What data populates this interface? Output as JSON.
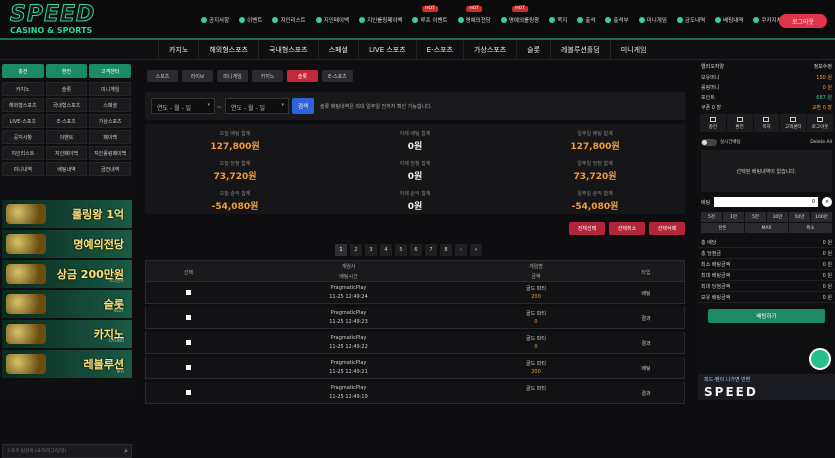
{
  "brand": {
    "name": "SPEED",
    "sub": "CASINO & SPORTS"
  },
  "topnav": [
    {
      "label": "공지사항",
      "hot": ""
    },
    {
      "label": "이벤트",
      "hot": ""
    },
    {
      "label": "지인리스트",
      "hot": ""
    },
    {
      "label": "지인페이백",
      "hot": ""
    },
    {
      "label": "지인롤링페이백",
      "hot": ""
    },
    {
      "label": "루프 이벤트",
      "hot": "HOT"
    },
    {
      "label": "명예의전당",
      "hot": "HOT"
    },
    {
      "label": "명예의롤링왕",
      "hot": "HOT"
    },
    {
      "label": "쪽지",
      "hot": ""
    },
    {
      "label": "출석",
      "hot": ""
    },
    {
      "label": "출석부",
      "hot": ""
    },
    {
      "label": "미니게임",
      "hot": ""
    },
    {
      "label": "금도내역",
      "hot": ""
    },
    {
      "label": "베팅내역",
      "hot": ""
    },
    {
      "label": "쿠카지쳐",
      "hot": ""
    }
  ],
  "logout_label": "로그아웃",
  "mainnav": [
    "카지노",
    "해외형스포츠",
    "국내형스포츠",
    "스페셜",
    "LIVE 스포츠",
    "E-스포츠",
    "가상스포츠",
    "슬롯",
    "레볼루션홀덤",
    "미니게임"
  ],
  "left": {
    "top_buttons": [
      "충전",
      "환전",
      "고객센터"
    ],
    "grid": [
      "카지노",
      "슬롯",
      "미니게임",
      "해외형스포츠",
      "국내형스포츠",
      "스페셜",
      "LIVE-스포츠",
      "E-스포츠",
      "가상스포츠",
      "공지사항",
      "이벤트",
      "페이백",
      "지인리스트",
      "지인페이백",
      "지인롤링페이백",
      "미니내역",
      "베팅내역",
      "금전내역"
    ],
    "banners": [
      {
        "title": "롤링왕 1억",
        "sub": ""
      },
      {
        "title": "명예의전당",
        "sub": ""
      },
      {
        "title": "상금 200만원",
        "sub": "토너먼트"
      },
      {
        "title": "슬롯",
        "sub": "SLOT"
      },
      {
        "title": "카지노",
        "sub": "CASINO"
      },
      {
        "title": "레볼루션",
        "sub": "홀덤"
      }
    ],
    "search_placeholder": "스포츠 팀검색 (국가/리그/팀명)"
  },
  "tabs": [
    "스포츠",
    "라이브",
    "미니게임",
    "카지노",
    "슬롯",
    "E-스포츠"
  ],
  "active_tab": 4,
  "filter": {
    "date_from": "연도 - 월 - 일",
    "date_to": "연도 - 월 - 일",
    "search_label": "검색",
    "note": "슬롯 배팅내역은 최대 일주일 전까지 확인 가능합니다."
  },
  "stats": [
    {
      "label": "오늘 배팅 합계",
      "value": "127,800원"
    },
    {
      "label": "어제 배팅 합계",
      "value": "0원"
    },
    {
      "label": "일주일 배팅 합계",
      "value": "127,800원"
    },
    {
      "label": "오늘 당첨 합계",
      "value": "73,720원"
    },
    {
      "label": "어제 당첨 합계",
      "value": "0원"
    },
    {
      "label": "일주일 당첨 합계",
      "value": "73,720원"
    },
    {
      "label": "오늘 순익 합계",
      "value": "-54,080원"
    },
    {
      "label": "어제 순익 합계",
      "value": "0원"
    },
    {
      "label": "일주일 순익 합계",
      "value": "-54,080원"
    }
  ],
  "actions": [
    "전체선택",
    "선택취소",
    "선택삭제"
  ],
  "pages": [
    "1",
    "2",
    "3",
    "4",
    "5",
    "6",
    "7",
    "8",
    "›",
    "»"
  ],
  "table": {
    "h_select": "선택",
    "h_game": "게임사",
    "h_time": "배팅시간",
    "h_gamename": "게임명",
    "h_amount": "금액",
    "h_type": "타입",
    "rows": [
      {
        "provider": "PragmaticPlay",
        "time": "11-25 12:49:24",
        "game": "골드 파티",
        "amount": "200",
        "type": "배팅"
      },
      {
        "provider": "PragmaticPlay",
        "time": "11-25 12:49:23",
        "game": "골드 파티",
        "amount": "0",
        "type": "결과"
      },
      {
        "provider": "PragmaticPlay",
        "time": "11-25 12:49:22",
        "game": "골드 파티",
        "amount": "0",
        "type": "결과"
      },
      {
        "provider": "PragmaticPlay",
        "time": "11-25 12:49:21",
        "game": "골드 파티",
        "amount": "200",
        "type": "배팅"
      },
      {
        "provider": "PragmaticPlay",
        "time": "11-25 12:49:19",
        "game": "골드 파티",
        "amount": "",
        "type": "결과"
      }
    ]
  },
  "right": {
    "user": "엘리오자양",
    "info_label": "정보수정",
    "lines": [
      {
        "label": "보유머니",
        "value": "150 원",
        "cls": "v"
      },
      {
        "label": "롤링머니",
        "value": "0 원",
        "cls": "v"
      },
      {
        "label": "포인트",
        "value": "687 원",
        "cls": "v g"
      },
      {
        "label": "쿠폰 0 장",
        "value": "교환 0 장",
        "cls": "v"
      }
    ],
    "icons": [
      "충전",
      "환전",
      "쪽지",
      "고객센터",
      "로그아웃"
    ],
    "toggle_label": "실시간배팅",
    "delete_label": "Delete All",
    "slip_text": "선택된 배팅내역이 없습니다.",
    "bet_label": "배팅",
    "bet_value": "0",
    "chips": [
      "5천",
      "1만",
      "5만",
      "10만",
      "50만",
      "100만"
    ],
    "chip_extra": [
      "잔돈",
      "MAX",
      "취소"
    ],
    "stats": [
      {
        "label": "총 배당",
        "value": "0 원"
      },
      {
        "label": "총 당첨금",
        "value": "0 원"
      },
      {
        "label": "최소 배팅금액",
        "value": "0 원"
      },
      {
        "label": "최대 배팅금액",
        "value": "0 원"
      },
      {
        "label": "최대 당첨금액",
        "value": "0 원"
      },
      {
        "label": "보유 배팅금액",
        "value": "0 원"
      }
    ],
    "bet_button": "배팅하기",
    "banner_t1": "피드-팬이 나가면 반환",
    "banner_t2": "SPEED"
  }
}
